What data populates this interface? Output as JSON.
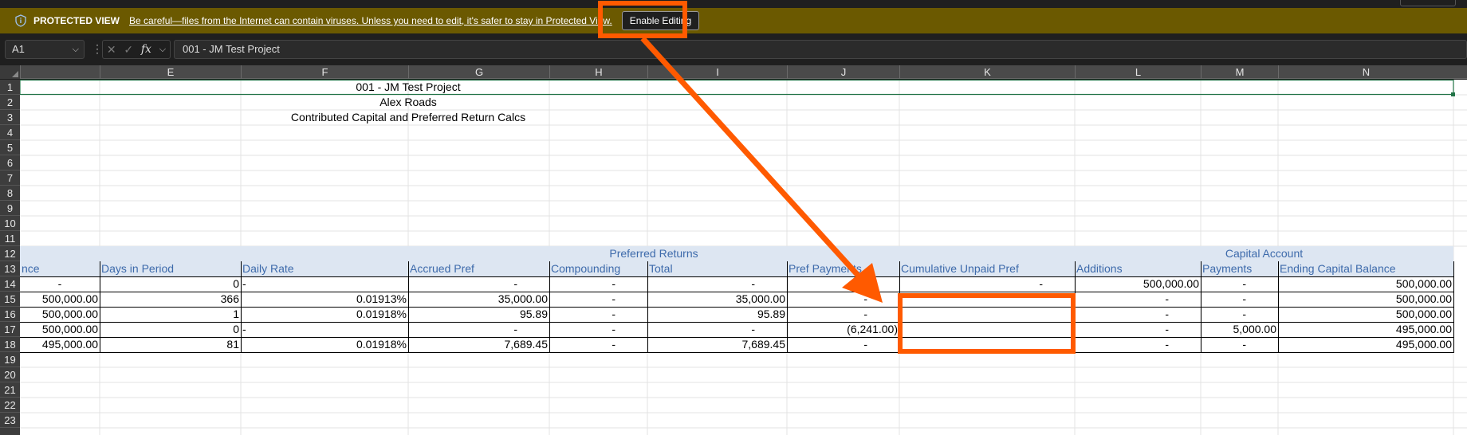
{
  "protected_view": {
    "title": "PROTECTED VIEW",
    "message": "Be careful—files from the Internet can contain viruses. Unless you need to edit, it's safer to stay in Protected View.",
    "enable_button": "Enable Editing"
  },
  "formula_bar": {
    "name_box": "A1",
    "content": "001 - JM Test Project",
    "fx_label": "fx"
  },
  "columns": [
    "E",
    "F",
    "G",
    "H",
    "I",
    "J",
    "K",
    "L",
    "M",
    "N"
  ],
  "rows": [
    "1",
    "2",
    "3",
    "4",
    "5",
    "6",
    "7",
    "8",
    "9",
    "10",
    "11",
    "12",
    "13",
    "14",
    "15",
    "16",
    "17",
    "18",
    "19",
    "20",
    "21",
    "22",
    "23"
  ],
  "titles": {
    "line1": "001 - JM Test Project",
    "line2": "Alex Roads",
    "line3": "Contributed Capital and Preferred Return Calcs"
  },
  "group_headers": {
    "preferred_returns": "Preferred Returns",
    "capital_account": "Capital Account"
  },
  "headers": {
    "balance_partial": "nce",
    "days": "Days in Period",
    "daily_rate": "Daily Rate",
    "accrued_pref": "Accrued Pref",
    "compounding": "Compounding",
    "total": "Total",
    "pref_payments": "Pref Payments",
    "cum_unpaid": "Cumulative Unpaid Pref",
    "additions": "Additions",
    "payments": "Payments",
    "ending_balance": "Ending Capital Balance"
  },
  "data_rows": [
    {
      "row": "14",
      "bal": "-",
      "days": "0",
      "rate": "-",
      "accrued": "-",
      "comp": "-",
      "total": "-",
      "pref_pay": "",
      "cum": "-",
      "add": "500,000.00",
      "pay": "-",
      "end": "500,000.00"
    },
    {
      "row": "15",
      "bal": "500,000.00",
      "days": "366",
      "rate": "0.01913%",
      "accrued": "35,000.00",
      "comp": "-",
      "total": "35,000.00",
      "pref_pay": "-",
      "cum": "",
      "add": "-",
      "pay": "-",
      "end": "500,000.00"
    },
    {
      "row": "16",
      "bal": "500,000.00",
      "days": "1",
      "rate": "0.01918%",
      "accrued": "95.89",
      "comp": "-",
      "total": "95.89",
      "pref_pay": "-",
      "cum": "",
      "add": "-",
      "pay": "-",
      "end": "500,000.00"
    },
    {
      "row": "17",
      "bal": "500,000.00",
      "days": "0",
      "rate": "-",
      "accrued": "-",
      "comp": "-",
      "total": "-",
      "pref_pay": "(6,241.00)",
      "cum": "",
      "add": "-",
      "pay": "5,000.00",
      "end": "495,000.00"
    },
    {
      "row": "18",
      "bal": "495,000.00",
      "days": "81",
      "rate": "0.01918%",
      "accrued": "7,689.45",
      "comp": "-",
      "total": "7,689.45",
      "pref_pay": "-",
      "cum": "",
      "add": "-",
      "pay": "-",
      "end": "495,000.00"
    }
  ],
  "colors": {
    "accent": "#ff5a00",
    "protected_bar": "#6b5900",
    "header_blue": "#3d6aab",
    "band": "#dde6f2"
  }
}
